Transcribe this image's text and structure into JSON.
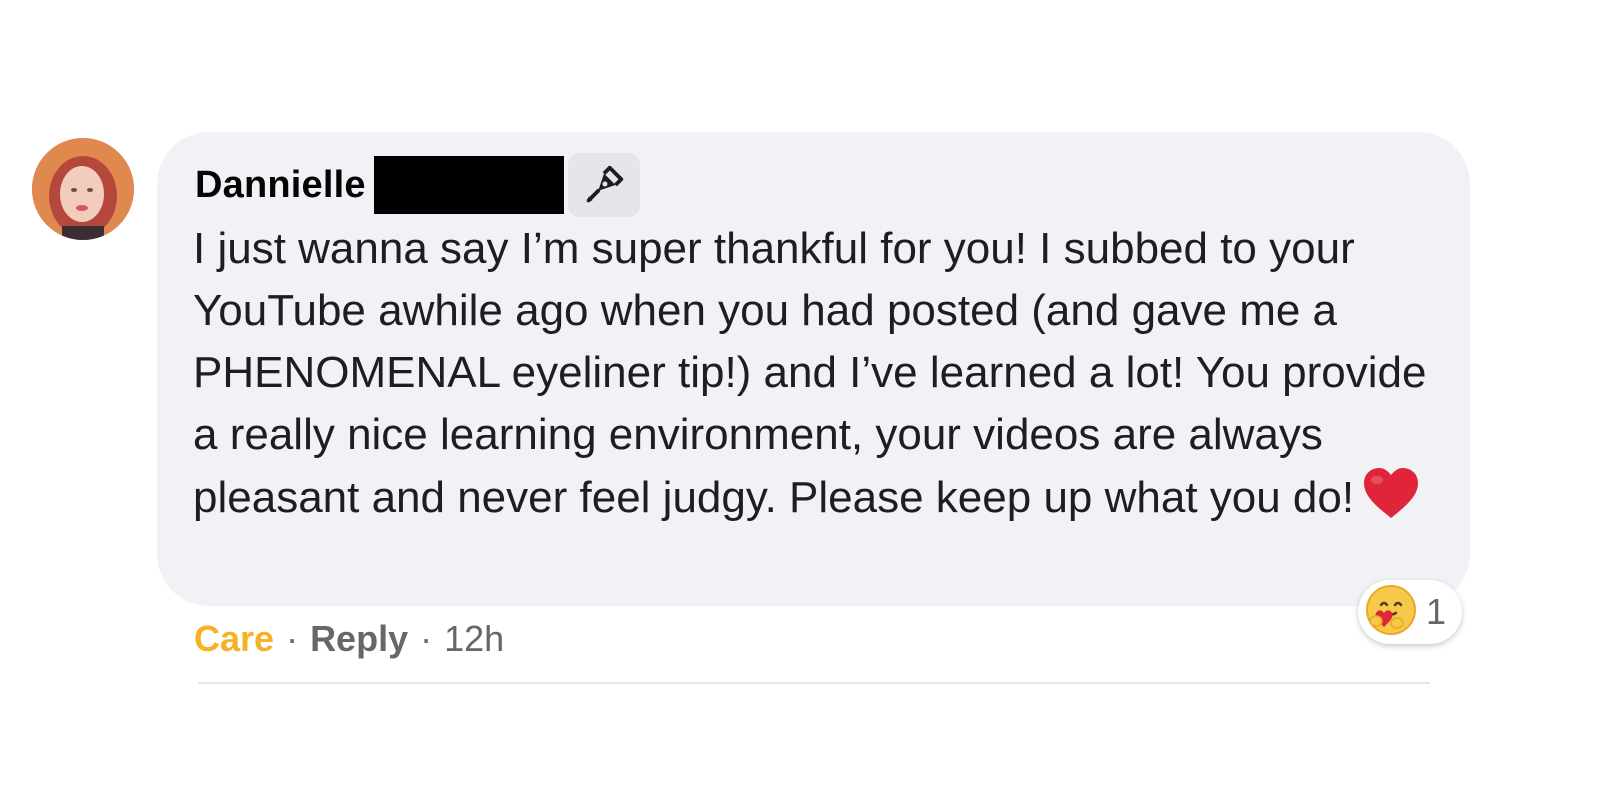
{
  "comment": {
    "author": "Dannielle",
    "text": "I just wanna say I’m super thankful for you! I subbed to your YouTube awhile ago when you had posted (and gave me a PHENOMENAL eyeliner tip!) and I’ve learned a lot! You provide a really nice learning environment, your videos are always pleasant and never feel judgy. Please keep up what you do!",
    "trailing_emoji_icon": "red-heart-icon",
    "author_badge_icon": "pen-nib-icon",
    "reaction": {
      "icon": "care-reaction-icon",
      "count": "1"
    },
    "actions": {
      "care_label": "Care",
      "separator": "·",
      "reply_label": "Reply",
      "timestamp": "12h"
    }
  },
  "colors": {
    "bubble_background": "#f0f2f5",
    "care_color": "#f7b125",
    "secondary_text": "#65676b",
    "primary_text": "#1c1e21",
    "heart_red": "#e0243a"
  }
}
